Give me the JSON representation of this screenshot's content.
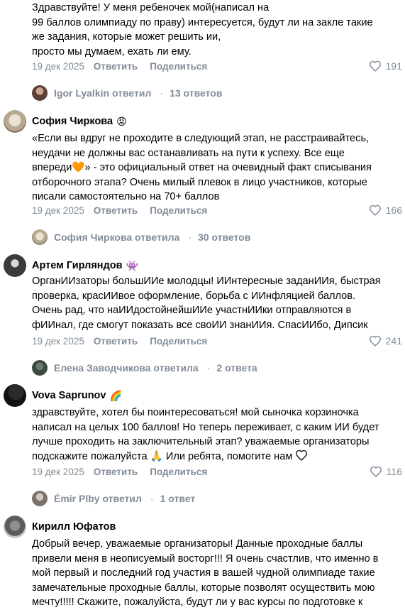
{
  "comments": [
    {
      "text": "Здравствуйте! У меня ребеночек мой(написал на\n99 баллов олимпиаду по праву) интересуется, будут ли на закле такие\nже задания, которые может решить ии,\nпросто мы думаем, ехать ли ему.",
      "date": "19 дек 2025",
      "reply_label": "Ответить",
      "share_label": "Поделиться",
      "likes": "191",
      "replies_author": "Igor Lyalkin ответил",
      "replies_count": "13 ответов"
    },
    {
      "author": "София Чиркова",
      "badge": "😡",
      "text": "«Если вы вдруг не проходите в следующий этап, не расстраивайтесь,\nнеудачи не должны вас останавливать на пути к успеху. Все еще\nвпереди🧡» - это официальный ответ на очевидный факт списывания\nотборочного этапа? Очень милый плевок в лицо участников, которые\nписали самостоятельно на 70+ баллов",
      "date": "19 дек 2025",
      "reply_label": "Ответить",
      "share_label": "Поделиться",
      "likes": "166",
      "replies_author": "София Чиркова ответила",
      "replies_count": "30 ответов"
    },
    {
      "author": "Артем Гирляндов",
      "badge": "👾",
      "text": "ОрганИИзаторы большИИе молодцы! ИИнтересные заданИИя, быстрая\nпроверка, красИИвое оформление, борьба с ИИнфляцией баллов.\nОчень рад, что наИИдостойнейшИИе участнИИки отправляются в\nфИИнал, где смогут показать все своИИ знанИИя. СпасИИбо, Дипсик",
      "date": "19 дек 2025",
      "reply_label": "Ответить",
      "share_label": "Поделиться",
      "likes": "241",
      "replies_author": "Елена Заводчикова ответила",
      "replies_count": "2 ответа"
    },
    {
      "author": "Vova Saprunov",
      "badge": "🌈",
      "text": "здравствуйте, хотел бы поинтересоваться! мой сыночка корзиночка\nнаписал на целых 100 баллов! Но теперь переживает, с каким ИИ будет\nлучше проходить на заключительный этап? уважаемые организаторы\nподскажите пожалуйста 🙏 Или ребята, помогите нам",
      "date": "19 дек 2025",
      "reply_label": "Ответить",
      "share_label": "Поделиться",
      "likes": "116",
      "replies_author": "Émir Plby ответил",
      "replies_count": "1 ответ"
    },
    {
      "author": "Кирилл Юфатов",
      "text": "Добрый вечер, уважаемые организаторы! Данные проходные баллы\nпривели меня в неописуемый восторг!!! Я очень счастлив, что именно в\nмой первый и последний год участия в вашей чудной олимпиаде такие\nзамечательные проходные баллы, которые позволят осуществить мою\nмечту!!!!! Скажите, пожалуйста, будут ли у вас курсы по подготовке к"
    }
  ],
  "colors": {
    "meta": "#818c99",
    "text": "#000000",
    "background": "#ffffff"
  },
  "icons": {
    "like": "heart-outline-icon"
  }
}
